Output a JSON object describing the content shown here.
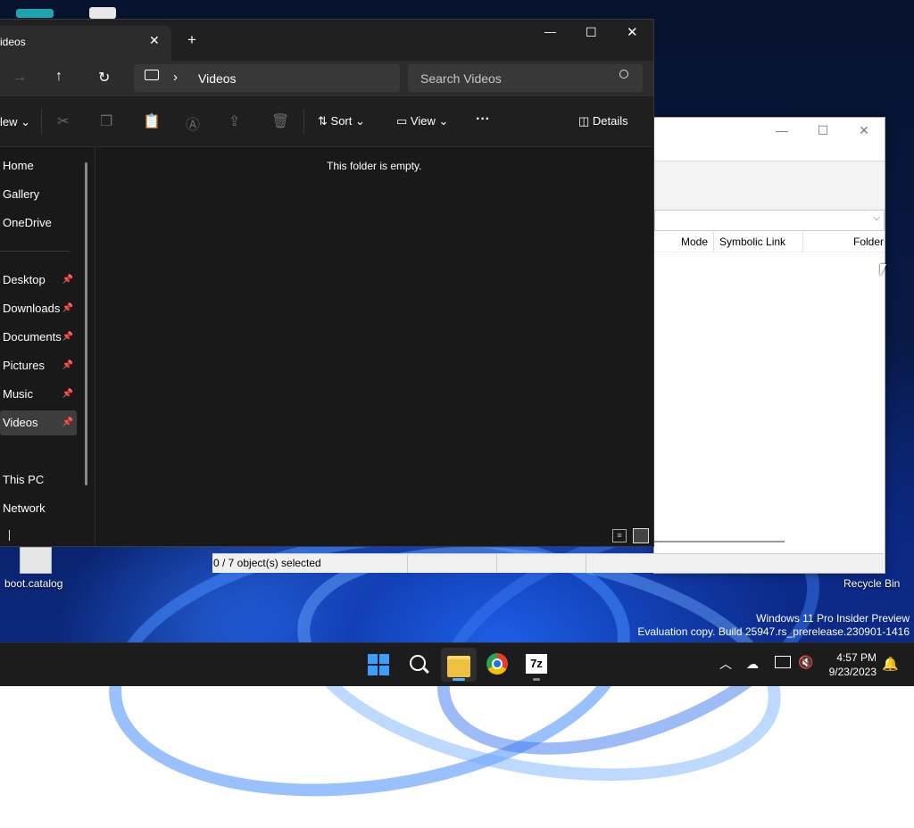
{
  "desktop": {
    "icons": [
      {
        "label": "boot.catalog"
      },
      {
        "label": "Recycle Bin"
      }
    ],
    "watermark_line1": "Windows 11 Pro Insider Preview",
    "watermark_line2": "Evaluation copy. Build 25947.rs_prerelease.230901-1416"
  },
  "explorer": {
    "tab_title": "ideos",
    "new_tab": "+",
    "window_controls": {
      "minimize": "—",
      "maximize": "☐",
      "close": "✕"
    },
    "breadcrumb_sep": "›",
    "breadcrumb_location": "Videos",
    "search_placeholder": "Search Videos",
    "command_bar": {
      "new_label": "lew",
      "sort_label": "Sort",
      "view_label": "View",
      "more_label": "···",
      "details_label": "Details"
    },
    "empty_message": "This folder is empty.",
    "sidebar": {
      "top": [
        "Home",
        "Gallery",
        "OneDrive"
      ],
      "pinned": [
        "Desktop",
        "Downloads",
        "Documents",
        "Pictures",
        "Music",
        "Videos"
      ],
      "bottom": [
        "This PC",
        "Network"
      ],
      "selected": "Videos"
    }
  },
  "sevenzip": {
    "columns": [
      "Mode",
      "Symbolic Link",
      "Folder"
    ],
    "status_text": "0 / 7 object(s) selected",
    "window_controls": {
      "minimize": "—",
      "maximize": "☐",
      "close": "✕"
    }
  },
  "taskbar": {
    "time": "4:57 PM",
    "date": "9/23/2023",
    "apps": [
      "start-icon",
      "search-icon",
      "file-explorer-icon",
      "chrome-icon",
      "7zip-icon"
    ],
    "sevenzip_glyph": "7z"
  },
  "colors": {
    "accent": "#0078d4",
    "explorer_bg": "#191919",
    "taskbar_bg": "#1c1c1c"
  }
}
